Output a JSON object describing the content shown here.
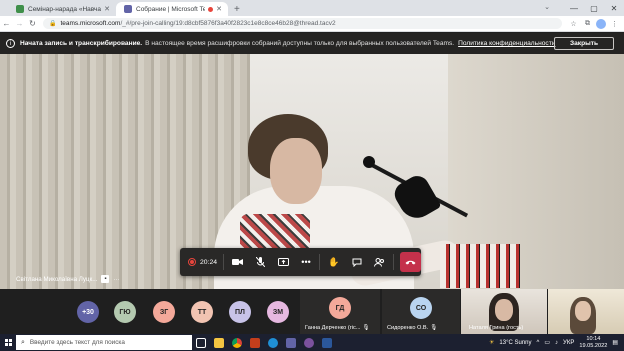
{
  "browser": {
    "tabs": [
      {
        "title": "Семінар-нарада «Навчання уч",
        "active": false
      },
      {
        "title": "Собрание | Microsoft Teams",
        "active": true
      }
    ],
    "url_host": "teams.microsoft.com",
    "url_path": "/_#/pre-join-calling/19:d8cbf5876f3a40f2823c1e8c8ce46b28@thread.tacv2"
  },
  "banner": {
    "bold_text": "Начата запись и транскрибирование.",
    "text": "В настоящее время расшифровки собраний доступны только для выбранных пользователей Teams.",
    "link": "Политика конфиденциальности",
    "close_label": "Закрыть"
  },
  "stage": {
    "participant_name": "Світлана Миколаївна Луцк..."
  },
  "controls": {
    "timer": "20:24"
  },
  "participants": {
    "more_count": "+30",
    "avatars": [
      {
        "initials": "ГЮ",
        "color": "#b4c9b0"
      },
      {
        "initials": "ЗГ",
        "color": "#f4a99a"
      },
      {
        "initials": "ТТ",
        "color": "#f2c4b2"
      },
      {
        "initials": "ПЛ",
        "color": "#c8c3e8"
      },
      {
        "initials": "ЗМ",
        "color": "#e6b8e0"
      }
    ],
    "tiles": [
      {
        "initials": "ГД",
        "color": "#f4a99a",
        "name": "Ганна Дерченко (гіс..."
      },
      {
        "initials": "СО",
        "color": "#b9d4f0",
        "name": "Сидоренко О.В."
      }
    ],
    "video_tiles": [
      {
        "name": "Наталя Грина (гость)"
      },
      {
        "name": ""
      }
    ]
  },
  "taskbar": {
    "search_placeholder": "Введите здесь текст для поиска",
    "weather": "13°C  Sunny",
    "lang": "УКР",
    "time": "10:14",
    "date": "19.05.2022"
  }
}
